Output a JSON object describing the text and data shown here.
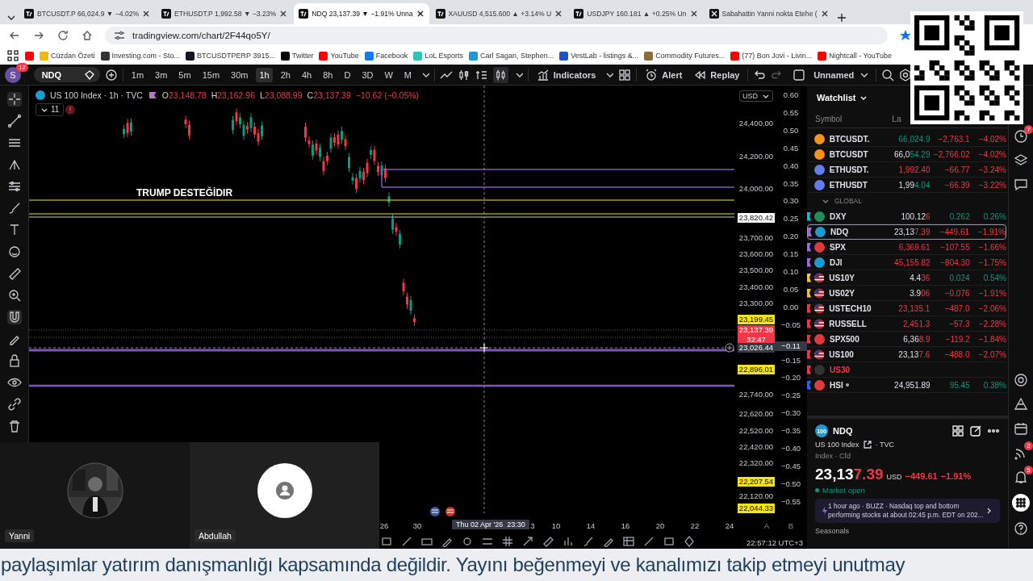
{
  "browser": {
    "tabs": [
      {
        "label": "BTCUSDT.P 66,024.9 ▼ −4.02%",
        "kind": "tv",
        "selected": false
      },
      {
        "label": "ETHUSDT.P 1,992.58 ▼ −3.23%",
        "kind": "tv",
        "selected": false
      },
      {
        "label": "NDQ 23,137.39 ▼ −1.91% Unna",
        "kind": "tv",
        "selected": true
      },
      {
        "label": "XAUUSD 4,515.600 ▲ +3.14% U",
        "kind": "tv",
        "selected": false
      },
      {
        "label": "USDJPY 160.181 ▲ +0.25% Un",
        "kind": "tv",
        "selected": false
      },
      {
        "label": "Sabahattin Yanni nokta Etehe (",
        "kind": "x",
        "selected": false
      }
    ],
    "url": "tradingview.com/chart/2F44qo5Y/",
    "bookmarks": [
      {
        "color": "#ff0000"
      },
      {
        "label": "Cüzdan Özeti",
        "color": "#f0b90b"
      },
      {
        "label": "Investing.com - Sto...",
        "color": "#333333"
      },
      {
        "label": "BTCUSDTPERP 3915...",
        "color": "#131722"
      },
      {
        "label": "Twitter",
        "color": "#000000"
      },
      {
        "label": "YouTube",
        "color": "#ff0000"
      },
      {
        "label": "Facebook",
        "color": "#1877f2"
      },
      {
        "label": "LoL Esports",
        "color": "#2ec4b6"
      },
      {
        "label": "Carl Sagan, Stephen...",
        "color": "#1a9bd7"
      },
      {
        "label": "VestLab - listings &...",
        "color": "#1e50c8"
      },
      {
        "label": "Commodity Futures...",
        "color": "#8a6d3b"
      },
      {
        "label": "(77) Bon Jovi - Livin...",
        "color": "#ff0000"
      },
      {
        "label": "Nightcall - YouTube",
        "color": "#ff0000"
      }
    ]
  },
  "toolbar": {
    "avatar": "S",
    "badge": "12",
    "symbol": "NDQ",
    "intervals": [
      {
        "label": "1m",
        "selected": false
      },
      {
        "label": "3m",
        "selected": false
      },
      {
        "label": "5m",
        "selected": false
      },
      {
        "label": "15m",
        "selected": false
      },
      {
        "label": "30m",
        "selected": false
      },
      {
        "label": "1h",
        "selected": true
      },
      {
        "label": "2h",
        "selected": false
      },
      {
        "label": "4h",
        "selected": false
      },
      {
        "label": "8h",
        "selected": false
      },
      {
        "label": "D",
        "selected": false
      },
      {
        "label": "3D",
        "selected": false
      },
      {
        "label": "W",
        "selected": false
      },
      {
        "label": "M",
        "selected": false
      }
    ],
    "indicators": "Indicators",
    "alert": "Alert",
    "replay": "Replay",
    "layout": "Unnamed"
  },
  "chart": {
    "title": "US 100 Index · 1h · TVC",
    "ohlc": [
      {
        "label": "O",
        "value": "23,148.78"
      },
      {
        "label": "H",
        "value": "23,162.96"
      },
      {
        "label": "L",
        "value": "23,088.99"
      },
      {
        "label": "C",
        "value": "23,137.39"
      }
    ],
    "change": "−10.62 (−0.05%)",
    "indicator_count": "11",
    "currency": "USD",
    "annotation": "TRUMP DESTEĞİDIR",
    "price_labels": [
      {
        "text": "24,400.00",
        "kind": "plain"
      },
      {
        "text": "24,200.00",
        "kind": "plain"
      },
      {
        "text": "24,000.00",
        "kind": "plain"
      },
      {
        "text": "23,820.42",
        "kind": "white"
      },
      {
        "text": "23,700.00",
        "kind": "plain"
      },
      {
        "text": "23,600.00",
        "kind": "plain"
      },
      {
        "text": "23,500.00",
        "kind": "plain"
      },
      {
        "text": "23,400.00",
        "kind": "plain"
      },
      {
        "text": "23,300.00",
        "kind": "plain"
      },
      {
        "text": "23,199.45",
        "kind": "yellow"
      },
      {
        "text": "23,137.39",
        "kind": "red",
        "countdown": "32:47"
      },
      {
        "text": "23,026.44",
        "kind": "dark"
      },
      {
        "text": "22,896.01",
        "kind": "yellow"
      },
      {
        "text": "22,740.00",
        "kind": "plain"
      },
      {
        "text": "22,620.00",
        "kind": "plain"
      },
      {
        "text": "22,520.00",
        "kind": "plain"
      },
      {
        "text": "22,420.00",
        "kind": "plain"
      },
      {
        "text": "22,320.00",
        "kind": "plain"
      },
      {
        "text": "22,207.54",
        "kind": "yellow"
      },
      {
        "text": "22,120.00",
        "kind": "plain"
      },
      {
        "text": "22,044.33",
        "kind": "yellow"
      }
    ],
    "right_axis": [
      {
        "text": "0.60",
        "kind": "plain"
      },
      {
        "text": "0.55",
        "kind": "plain"
      },
      {
        "text": "0.50",
        "kind": "plain"
      },
      {
        "text": "0.45",
        "kind": "plain"
      },
      {
        "text": "0.40",
        "kind": "plain"
      },
      {
        "text": "0.35",
        "kind": "plain"
      },
      {
        "text": "0.30",
        "kind": "plain"
      },
      {
        "text": "0.25",
        "kind": "plain"
      },
      {
        "text": "0.20",
        "kind": "plain"
      },
      {
        "text": "0.15",
        "kind": "plain"
      },
      {
        "text": "0.10",
        "kind": "plain"
      },
      {
        "text": "0.05",
        "kind": "plain"
      },
      {
        "text": "0.00",
        "kind": "plain"
      },
      {
        "text": "−0.05",
        "kind": "plain"
      },
      {
        "text": "−0.11",
        "kind": "dark"
      },
      {
        "text": "−0.15",
        "kind": "plain"
      },
      {
        "text": "−0.20",
        "kind": "plain"
      },
      {
        "text": "−0.25",
        "kind": "plain"
      },
      {
        "text": "−0.30",
        "kind": "plain"
      },
      {
        "text": "−0.35",
        "kind": "plain"
      },
      {
        "text": "−0.40",
        "kind": "plain"
      },
      {
        "text": "−0.45",
        "kind": "plain"
      },
      {
        "text": "−0.50",
        "kind": "plain"
      },
      {
        "text": "−0.55",
        "kind": "plain"
      }
    ],
    "time_labels": [
      "26",
      "30",
      "3",
      "10",
      "14",
      "16",
      "20",
      "22",
      "24"
    ],
    "crosshair_time": "Thu 02 Apr '26  23:30",
    "clock": "22:57:12 UTC+3",
    "axis_buttons": [
      "A",
      "B"
    ]
  },
  "watchlist": {
    "title": "Watchlist",
    "columns": [
      "Symbol",
      "La"
    ],
    "section": "GLOBAL",
    "rows": [
      {
        "symbol": "BTCUSDT.",
        "logo": {
          "kind": "coin",
          "color": "#f7931a"
        },
        "last_tail": "66,024.9",
        "last_up": true,
        "change": "−2,763.1",
        "pct": "−4.02%",
        "change_up": false,
        "selected": false
      },
      {
        "symbol": "BTCUSDT",
        "logo": {
          "kind": "coin",
          "color": "#f7931a"
        },
        "last_head": "66,0",
        "last_tail": "54.29",
        "last_up": true,
        "change": "−2,766.02",
        "pct": "−4.02%",
        "change_up": false,
        "selected": false
      },
      {
        "symbol": "ETHUSDT.",
        "logo": {
          "kind": "coin",
          "color": "#627eea"
        },
        "last_tail": "1,992.40",
        "last_up": false,
        "change": "−66.77",
        "pct": "−3.24%",
        "change_up": false,
        "selected": false
      },
      {
        "symbol": "ETHUSDT",
        "logo": {
          "kind": "coin",
          "color": "#627eea"
        },
        "last_head": "1,99",
        "last_tail": "4.04",
        "last_up": true,
        "change": "−66.39",
        "pct": "−3.22%",
        "change_up": false,
        "selected": false
      },
      {
        "section_break": true,
        "symbol": "DXY",
        "color": "#00bcd4",
        "logo": {
          "kind": "coin",
          "color": "#1e8f5a"
        },
        "last_head": "100.12",
        "last_tail": "6",
        "last_up": false,
        "change": "0.262",
        "pct": "0.26%",
        "change_up": true,
        "selected": false
      },
      {
        "symbol": "NDQ",
        "color": "#9c6ade",
        "logo": {
          "kind": "coin",
          "color": "#1b9bd1"
        },
        "last_head": "23,13",
        "last_tail": "7.39",
        "last_up": false,
        "change": "−449.61",
        "pct": "−1.91%",
        "change_up": false,
        "selected": true
      },
      {
        "symbol": "SPX",
        "color": "#9c6ade",
        "logo": {
          "kind": "coin",
          "color": "#e03a3a"
        },
        "last_tail": "6,369.61",
        "last_up": false,
        "change": "−107.55",
        "pct": "−1.66%",
        "change_up": false,
        "selected": false
      },
      {
        "symbol": "DJI",
        "color": "#9c6ade",
        "logo": {
          "kind": "coin",
          "color": "#1b9bd1"
        },
        "last_tail": "45,155.82",
        "last_up": false,
        "change": "−804.30",
        "pct": "−1.75%",
        "change_up": false,
        "selected": false
      },
      {
        "symbol": "US10Y",
        "color": "#f5c518",
        "logo": {
          "kind": "usflag",
          "color": "#b22234"
        },
        "last_head": "4.4",
        "last_tail": "36",
        "last_up": false,
        "change": "0.024",
        "pct": "0.54%",
        "change_up": true,
        "selected": false
      },
      {
        "symbol": "US02Y",
        "color": "#f5c518",
        "logo": {
          "kind": "usflag",
          "color": "#b22234"
        },
        "last_head": "3.9",
        "last_tail": "06",
        "last_up": false,
        "change": "−0.076",
        "pct": "−1.91%",
        "change_up": false,
        "selected": false
      },
      {
        "symbol": "USTECH10",
        "color": "#f23645",
        "logo": {
          "kind": "usflag",
          "color": "#b22234"
        },
        "last_tail": "23,135.1",
        "last_up": false,
        "change": "−487.0",
        "pct": "−2.06%",
        "change_up": false,
        "selected": false
      },
      {
        "symbol": "RUSSELL",
        "color": "#f23645",
        "logo": {
          "kind": "usflag",
          "color": "#b22234"
        },
        "last_tail": "2,451.3",
        "last_up": false,
        "change": "−57.3",
        "pct": "−2.28%",
        "change_up": false,
        "selected": false
      },
      {
        "symbol": "SPX500",
        "color": "#f23645",
        "logo": {
          "kind": "coin",
          "color": "#e03a3a"
        },
        "last_head": "6,36",
        "last_tail": "8.9",
        "last_up": false,
        "change": "−119.2",
        "pct": "−1.84%",
        "change_up": false,
        "selected": false
      },
      {
        "symbol": "US100",
        "color": "#f23645",
        "logo": {
          "kind": "usflag",
          "color": "#b22234"
        },
        "last_head": "23,13",
        "last_tail": "7.6",
        "last_up": false,
        "change": "−488.0",
        "pct": "−2.07%",
        "change_up": false,
        "selected": false
      },
      {
        "symbol": "US30",
        "color": "#f23645",
        "logo": {
          "kind": "coin",
          "color": "#333333"
        },
        "inactive": true,
        "selected": false
      },
      {
        "symbol": "HSI",
        "color": "#2962ff",
        "logo": {
          "kind": "coin",
          "color": "#e03a3a"
        },
        "dot": true,
        "last_head": "24,951.89",
        "change": "95.45",
        "pct": "0.38%",
        "change_up": true,
        "selected": false
      }
    ]
  },
  "details": {
    "logo": "100",
    "symbol": "NDQ",
    "name": "US 100 Index",
    "exchange": "· TVC",
    "type": "Index · Cfd",
    "price_head": "23,13",
    "price_tail": "7.39",
    "currency": "USD",
    "change": "−449.61",
    "change_pct": "−1.91%",
    "status": "Market open",
    "news": "1 hour ago · BUZZ · Nasdaq top and bottom performing stocks at about 02:45 p.m. EDT on 202...",
    "section": "Seasonals"
  },
  "right_rail_badges": [
    "7",
    "2",
    "5"
  ],
  "call": {
    "participants": [
      {
        "name": "Yanni",
        "kind": "video"
      },
      {
        "name": "Abdullah",
        "kind": "avatar"
      }
    ]
  },
  "caption": "paylaşımlar yatırım danışmanlığı kapsamında değildir. Yayını beğenmeyi ve kanalımızı takip etmeyi unutmay"
}
